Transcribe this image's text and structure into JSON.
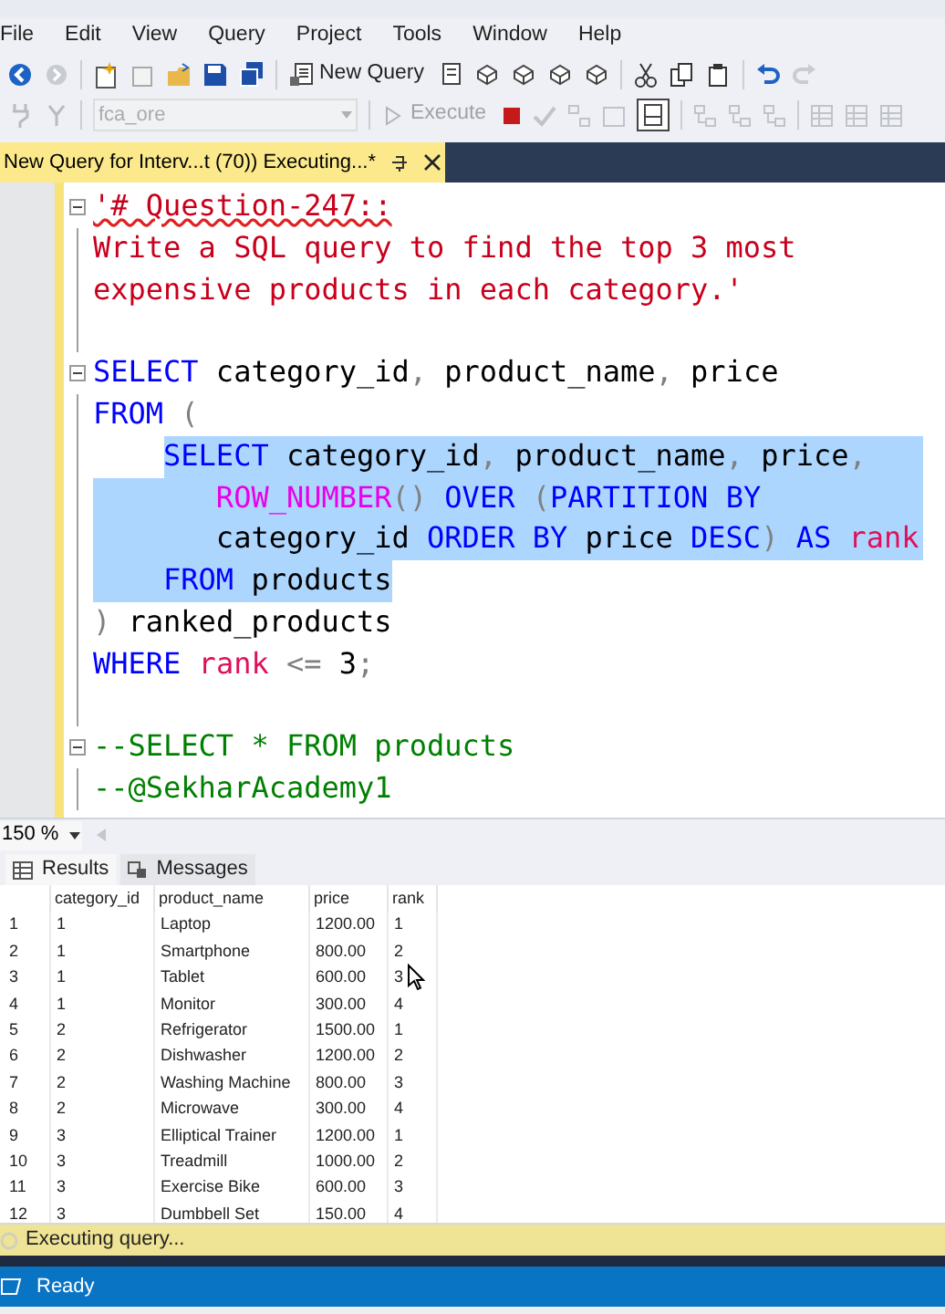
{
  "menu": [
    "File",
    "Edit",
    "View",
    "Query",
    "Project",
    "Tools",
    "Window",
    "Help"
  ],
  "toolbar": {
    "new_query_label": "New Query",
    "database": "fca_ore",
    "execute_label": "Execute"
  },
  "document_tab": {
    "title": "New Query for Interv...t (70)) Executing...*",
    "selected": true
  },
  "editor": {
    "lines": [
      {
        "collapsible": true,
        "indented": false,
        "eol_selected": false,
        "tokens": [
          {
            "text": "'# Question-247::",
            "kind": "string_flagged",
            "selected": false
          }
        ]
      },
      {
        "collapsible": false,
        "indented": false,
        "eol_selected": false,
        "tokens": [
          {
            "text": "Write a SQL query to find the top 3 most",
            "kind": "string",
            "selected": false
          }
        ]
      },
      {
        "collapsible": false,
        "indented": false,
        "eol_selected": false,
        "tokens": [
          {
            "text": "expensive products in each category.'",
            "kind": "string",
            "selected": false
          }
        ]
      },
      {
        "collapsible": false,
        "eol_selected": false
      },
      {
        "collapsible": true,
        "indented": false,
        "eol_selected": false,
        "tokens": [
          {
            "text": "SELECT",
            "kind": "keyword",
            "selected": false
          },
          {
            "text": " category_id",
            "kind": "plain",
            "selected": false
          },
          {
            "text": ",",
            "kind": "operator",
            "selected": false
          },
          {
            "text": " product_name",
            "kind": "plain",
            "selected": false
          },
          {
            "text": ",",
            "kind": "operator",
            "selected": false
          },
          {
            "text": " price",
            "kind": "plain",
            "selected": false
          }
        ]
      },
      {
        "collapsible": false,
        "indented": false,
        "eol_selected": false,
        "tokens": [
          {
            "text": "FROM",
            "kind": "keyword",
            "selected": false
          },
          {
            "text": " (",
            "kind": "operator",
            "selected": false
          }
        ]
      },
      {
        "collapsible": false,
        "indented": true,
        "indent_selected": false,
        "eol_selected": true,
        "tokens": [
          {
            "text": "SELECT",
            "kind": "keyword",
            "selected": true
          },
          {
            "text": " category_id",
            "kind": "plain",
            "selected": true
          },
          {
            "text": ",",
            "kind": "operator",
            "selected": true
          },
          {
            "text": " product_name",
            "kind": "plain",
            "selected": true
          },
          {
            "text": ",",
            "kind": "operator",
            "selected": true
          },
          {
            "text": " price",
            "kind": "plain",
            "selected": true
          },
          {
            "text": ",",
            "kind": "operator",
            "selected": true
          }
        ]
      },
      {
        "collapsible": false,
        "indented": true,
        "indent_selected": true,
        "eol_selected": true,
        "tokens": [
          {
            "text": "   ROW_NUMBER",
            "kind": "function",
            "selected": true
          },
          {
            "text": "() ",
            "kind": "operator",
            "selected": true
          },
          {
            "text": "OVER ",
            "kind": "keyword",
            "selected": true
          },
          {
            "text": "(",
            "kind": "operator",
            "selected": true
          },
          {
            "text": "PARTITION BY",
            "kind": "keyword",
            "selected": true
          }
        ]
      },
      {
        "collapsible": false,
        "indented": true,
        "indent_selected": true,
        "eol_selected": true,
        "tokens": [
          {
            "text": "   category_id ",
            "kind": "plain",
            "selected": true
          },
          {
            "text": "ORDER BY",
            "kind": "keyword",
            "selected": true
          },
          {
            "text": " price ",
            "kind": "plain",
            "selected": true
          },
          {
            "text": "DESC",
            "kind": "keyword",
            "selected": true
          },
          {
            "text": ") ",
            "kind": "operator",
            "selected": true
          },
          {
            "text": "AS ",
            "kind": "keyword",
            "selected": true
          },
          {
            "text": "rank",
            "kind": "reserved",
            "selected": true
          }
        ]
      },
      {
        "collapsible": false,
        "indented": true,
        "indent_selected": true,
        "eol_selected": false,
        "tokens": [
          {
            "text": "FROM",
            "kind": "keyword",
            "selected": true
          },
          {
            "text": " products",
            "kind": "plain",
            "selected": true
          }
        ]
      },
      {
        "collapsible": false,
        "indented": false,
        "eol_selected": false,
        "tokens": [
          {
            "text": ")",
            "kind": "operator",
            "selected": false
          },
          {
            "text": " ranked_products",
            "kind": "plain",
            "selected": false
          }
        ]
      },
      {
        "collapsible": false,
        "indented": false,
        "eol_selected": false,
        "tokens": [
          {
            "text": "WHERE",
            "kind": "keyword",
            "selected": false
          },
          {
            "text": " rank",
            "kind": "reserved",
            "selected": false
          },
          {
            "text": " <=",
            "kind": "operator",
            "selected": false
          },
          {
            "text": " 3",
            "kind": "plain",
            "selected": false
          },
          {
            "text": ";",
            "kind": "operator",
            "selected": false
          }
        ]
      },
      {
        "collapsible": false,
        "eol_selected": false
      },
      {
        "collapsible": true,
        "indented": false,
        "eol_selected": false,
        "tokens": [
          {
            "text": "--SELECT * FROM products",
            "kind": "comment",
            "selected": false
          }
        ]
      },
      {
        "collapsible": false,
        "indented": false,
        "eol_selected": false,
        "tokens": [
          {
            "text": "--@SekharAcademy1",
            "kind": "comment",
            "selected": false
          }
        ]
      }
    ]
  },
  "zoom": "150 %",
  "result_tabs": [
    {
      "label": "Results",
      "selected": true
    },
    {
      "label": "Messages",
      "selected": false
    }
  ],
  "grid": {
    "columns": [
      "",
      "category_id",
      "product_name",
      "price",
      "rank"
    ],
    "rows": [
      [
        "1",
        "1",
        "Laptop",
        "1200.00",
        "1"
      ],
      [
        "2",
        "1",
        "Smartphone",
        "800.00",
        "2"
      ],
      [
        "3",
        "1",
        "Tablet",
        "600.00",
        "3"
      ],
      [
        "4",
        "1",
        "Monitor",
        "300.00",
        "4"
      ],
      [
        "5",
        "2",
        "Refrigerator",
        "1500.00",
        "1"
      ],
      [
        "6",
        "2",
        "Dishwasher",
        "1200.00",
        "2"
      ],
      [
        "7",
        "2",
        "Washing Machine",
        "800.00",
        "3"
      ],
      [
        "8",
        "2",
        "Microwave",
        "300.00",
        "4"
      ],
      [
        "9",
        "3",
        "Elliptical Trainer",
        "1200.00",
        "1"
      ],
      [
        "10",
        "3",
        "Treadmill",
        "1000.00",
        "2"
      ],
      [
        "11",
        "3",
        "Exercise Bike",
        "600.00",
        "3"
      ],
      [
        "12",
        "3",
        "Dumbbell Set",
        "150.00",
        "4"
      ]
    ]
  },
  "query_status": "Executing query...",
  "status_bar": "Ready"
}
